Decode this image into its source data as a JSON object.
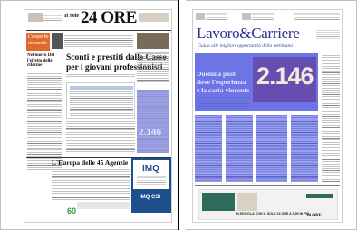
{
  "left_page": {
    "masthead_prefix": "Il Sole",
    "masthead_number": "24 ORE",
    "section_label_1": "L'esperto",
    "section_label_2": "risponde",
    "teaser_1": "Sconti e prestiti dalle Casse",
    "teaser_2": "per i giovani professionisti",
    "left_col_title": "Nel nuovo Def l'effetto delle riforme",
    "europe_headline": "L'Europa delle 45 Agenzie",
    "number_box": "2.146",
    "ad_brand": "IMQ",
    "ad_brand_2": "IMQ  CSI",
    "footer_number": "60",
    "colors": {
      "masthead_bg": "#ffffff",
      "orange": "#e06a2b",
      "blue_highlight": "#3a46dc",
      "ad_blue": "#1f4e8c"
    }
  },
  "right_page": {
    "title": "Lavoro&Carriere",
    "subtitle": "Guida alle migliori opportunità della settimana",
    "big_number": "2.146",
    "headline_1": "Duemila posti",
    "headline_2": "dove l'esperienza",
    "headline_3": "è la carta vincente",
    "promo_1": "IN EDICOLA CON IL SOLE 24 ORE A 9,90 IN PIÙ",
    "promo_brand": "24 ORE",
    "colors": {
      "highlight": "#3f48d8",
      "orange": "#e06a2b",
      "promo_bg": "#f2f2f2"
    }
  }
}
